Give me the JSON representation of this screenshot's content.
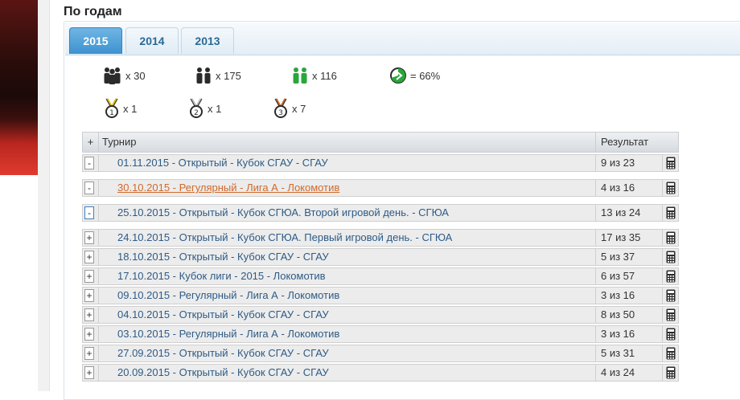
{
  "section_title": "По годам",
  "tabs": [
    {
      "label": "2015",
      "active": true
    },
    {
      "label": "2014",
      "active": false
    },
    {
      "label": "2013",
      "active": false
    }
  ],
  "stats": [
    {
      "icon": "team-icon",
      "value": "x 30"
    },
    {
      "icon": "players-icon",
      "value": "x 175"
    },
    {
      "icon": "players-green-icon",
      "value": "x 116"
    },
    {
      "icon": "percent-circle-icon",
      "value": "= 66%"
    }
  ],
  "medals": [
    {
      "icon": "medal-1-icon",
      "value": "x 1"
    },
    {
      "icon": "medal-2-icon",
      "value": "x 1"
    },
    {
      "icon": "medal-3-icon",
      "value": "x 7"
    }
  ],
  "table": {
    "header_toggle": "+",
    "header_name": "Турнир",
    "header_result": "Результат",
    "rows": [
      {
        "toggle": "-",
        "name": "01.11.2015 - Открытый - Кубок СГАУ - СГАУ",
        "result": "9 из 23"
      },
      {
        "toggle": "-",
        "name": "30.10.2015 - Регулярный - Лига А - Локомотив",
        "result": "4 из 16"
      },
      {
        "toggle": "-",
        "name": "25.10.2015 - Открытый - Кубок СГЮА. Второй игровой день. - СГЮА",
        "result": "13 из 24"
      },
      {
        "toggle": "+",
        "name": "24.10.2015 - Открытый - Кубок СГЮА. Первый игровой день. - СГЮА",
        "result": "17 из 35"
      },
      {
        "toggle": "+",
        "name": "18.10.2015 - Открытый - Кубок СГАУ - СГАУ",
        "result": "5 из 37"
      },
      {
        "toggle": "+",
        "name": "17.10.2015 - Кубок лиги - 2015 - Локомотив",
        "result": "6 из 57"
      },
      {
        "toggle": "+",
        "name": "09.10.2015 - Регулярный - Лига А - Локомотив",
        "result": "3 из 16"
      },
      {
        "toggle": "+",
        "name": "04.10.2015 - Открытый - Кубок СГАУ - СГАУ",
        "result": "8 из 50"
      },
      {
        "toggle": "+",
        "name": "03.10.2015 - Регулярный - Лига А - Локомотив",
        "result": "3 из 16"
      },
      {
        "toggle": "+",
        "name": "27.09.2015 - Открытый - Кубок СГАУ - СГАУ",
        "result": "5 из 31"
      },
      {
        "toggle": "+",
        "name": "20.09.2015 - Открытый - Кубок СГАУ - СГАУ",
        "result": "4 из 24"
      }
    ]
  },
  "colors": {
    "tab_active": "#3e92cf",
    "link": "#2d5b86",
    "link_hover": "#d2692a",
    "green": "#2aa63c"
  }
}
